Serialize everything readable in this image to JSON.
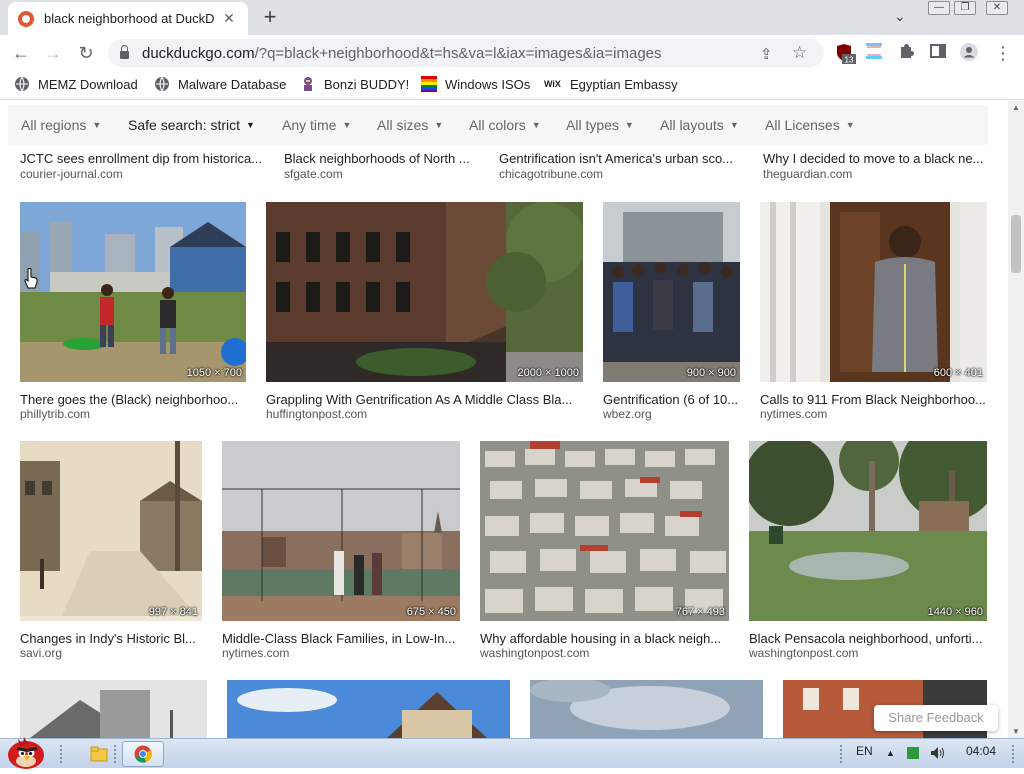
{
  "browser": {
    "tab_title": "black neighborhood at DuckD",
    "tab_close": "✕",
    "new_tab": "+",
    "tab_search": "⌄",
    "window_buttons": [
      "—",
      "❐",
      "✕"
    ],
    "url_host": "duckduckgo.com",
    "url_path": "/?q=black+neighborhood&t=hs&va=l&iax=images&ia=images",
    "extension_badge": "13",
    "nav": {
      "back": "←",
      "forward": "→",
      "reload": "↻"
    },
    "omnibox_icons": {
      "share": "⇪",
      "star": "☆"
    },
    "menu": "⋮"
  },
  "bookmarks": [
    {
      "label": "MEMZ Download",
      "icon": "globe-icon"
    },
    {
      "label": "Malware Database",
      "icon": "globe-icon"
    },
    {
      "label": "Bonzi BUDDY!",
      "icon": "bonzi-icon"
    },
    {
      "label": "Windows ISOs",
      "icon": "windows-flag-icon"
    },
    {
      "label": "Egyptian Embassy",
      "icon": "wix-icon",
      "icon_text": "WiX"
    }
  ],
  "filters": [
    {
      "label": "All regions",
      "strong": false
    },
    {
      "label": "Safe search: strict",
      "strong": true
    },
    {
      "label": "Any time",
      "strong": false
    },
    {
      "label": "All sizes",
      "strong": false
    },
    {
      "label": "All colors",
      "strong": false
    },
    {
      "label": "All types",
      "strong": false
    },
    {
      "label": "All layouts",
      "strong": false
    },
    {
      "label": "All Licenses",
      "strong": false
    }
  ],
  "caret": "▼",
  "results_row0": [
    {
      "title": "JCTC sees enrollment dip from historica...",
      "source": "courier-journal.com"
    },
    {
      "title": "Black neighborhoods of North ...",
      "source": "sfgate.com"
    },
    {
      "title": "Gentrification isn't America's urban sco...",
      "source": "chicagotribune.com"
    },
    {
      "title": "Why I decided to move to a black ne...",
      "source": "theguardian.com"
    }
  ],
  "results_row1": [
    {
      "title": "There goes the (Black) neighborhoo...",
      "source": "phillytrib.com",
      "dims": "1050 × 700"
    },
    {
      "title": "Grappling With Gentrification As A Middle Class Bla...",
      "source": "huffingtonpost.com",
      "dims": "2000 × 1000"
    },
    {
      "title": "Gentrification (6 of 10...",
      "source": "wbez.org",
      "dims": "900 × 900"
    },
    {
      "title": "Calls to 911 From Black Neighborhoo...",
      "source": "nytimes.com",
      "dims": "600 × 401"
    }
  ],
  "results_row2": [
    {
      "title": "Changes in Indy's Historic Bl...",
      "source": "savi.org",
      "dims": "997 × 841"
    },
    {
      "title": "Middle-Class Black Families, in Low-In...",
      "source": "nytimes.com",
      "dims": "675 × 450"
    },
    {
      "title": "Why affordable housing in a black neigh...",
      "source": "washingtonpost.com",
      "dims": "767 × 493"
    },
    {
      "title": "Black Pensacola neighborhood, unforti...",
      "source": "washingtonpost.com",
      "dims": "1440 × 960"
    }
  ],
  "feedback": "Share Feedback",
  "taskbar": {
    "lang": "EN",
    "time": "04:04"
  }
}
